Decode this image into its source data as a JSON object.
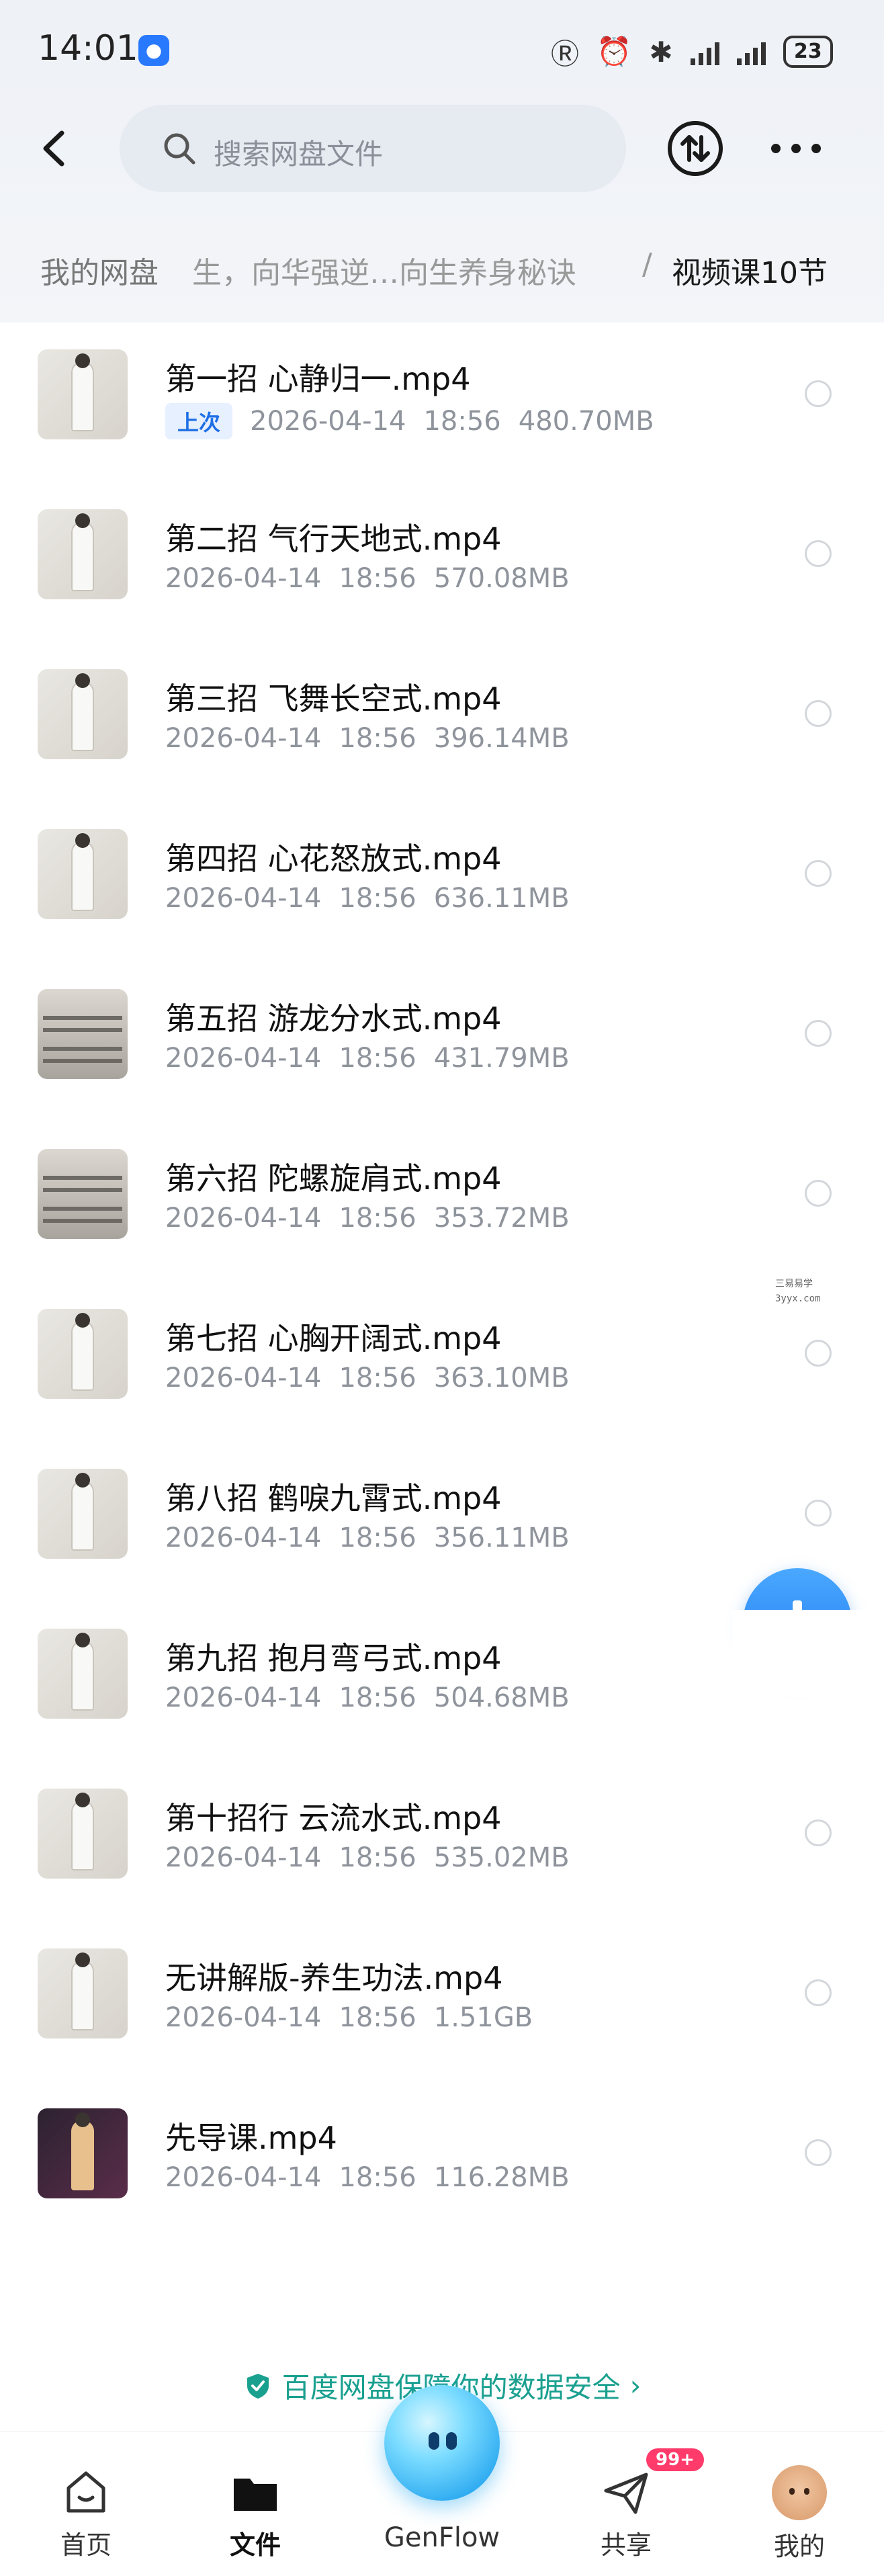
{
  "status_bar": {
    "time": "14:01",
    "notify_icon": "bulb-icon",
    "battery": "23"
  },
  "header": {
    "search_placeholder": "搜索网盘文件",
    "back_icon": "back-arrow-icon",
    "transfer_icon": "transfer-icon",
    "more_icon": "more-icon"
  },
  "breadcrumb": {
    "root": "我的网盘",
    "middle": "生，向华强逆…向生养身秘诀",
    "separator": "/",
    "current": "视频课10节"
  },
  "files": [
    {
      "name": "第一招 心静归一.mp4",
      "tag": "上次",
      "date": "2026-04-14",
      "time": "18:56",
      "size": "480.70MB"
    },
    {
      "name": "第二招 气行天地式.mp4",
      "tag": "",
      "date": "2026-04-14",
      "time": "18:56",
      "size": "570.08MB"
    },
    {
      "name": "第三招 飞舞长空式.mp4",
      "tag": "",
      "date": "2026-04-14",
      "time": "18:56",
      "size": "396.14MB"
    },
    {
      "name": "第四招 心花怒放式.mp4",
      "tag": "",
      "date": "2026-04-14",
      "time": "18:56",
      "size": "636.11MB"
    },
    {
      "name": "第五招 游龙分水式.mp4",
      "tag": "",
      "date": "2026-04-14",
      "time": "18:56",
      "size": "431.79MB"
    },
    {
      "name": "第六招 陀螺旋肩式.mp4",
      "tag": "",
      "date": "2026-04-14",
      "time": "18:56",
      "size": "353.72MB"
    },
    {
      "name": "第七招 心胸开阔式.mp4",
      "tag": "",
      "date": "2026-04-14",
      "time": "18:56",
      "size": "363.10MB"
    },
    {
      "name": "第八招 鹤唳九霄式.mp4",
      "tag": "",
      "date": "2026-04-14",
      "time": "18:56",
      "size": "356.11MB"
    },
    {
      "name": "第九招 抱月弯弓式.mp4",
      "tag": "",
      "date": "2026-04-14",
      "time": "18:56",
      "size": "504.68MB"
    },
    {
      "name": "第十招行 云流水式.mp4",
      "tag": "",
      "date": "2026-04-14",
      "time": "18:56",
      "size": "535.02MB"
    },
    {
      "name": "无讲解版-养生功法.mp4",
      "tag": "",
      "date": "2026-04-14",
      "time": "18:56",
      "size": "1.51GB"
    },
    {
      "name": "先导课.mp4",
      "tag": "",
      "date": "2026-04-14",
      "time": "18:56",
      "size": "116.28MB"
    }
  ],
  "watermark": {
    "line1": "三易易学",
    "line2": "3yyx.com"
  },
  "security_banner": "百度网盘保障你的数据安全",
  "bottom_nav": [
    {
      "label": "首页",
      "icon": "home-icon"
    },
    {
      "label": "文件",
      "icon": "folder-icon"
    },
    {
      "label": "GenFlow",
      "icon": "genflow-orb-icon"
    },
    {
      "label": "共享",
      "icon": "share-icon",
      "badge": "99+"
    },
    {
      "label": "我的",
      "icon": "avatar-icon"
    }
  ],
  "colors": {
    "accent": "#1f7bf0",
    "secure": "#1aa08f",
    "badge": "#ff3b6b"
  }
}
